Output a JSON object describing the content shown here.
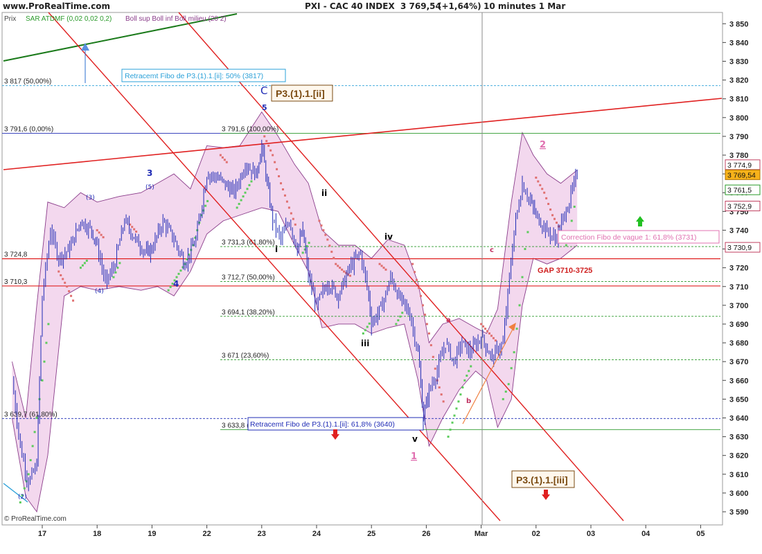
{
  "header": {
    "site": "www.ProRealTime.com",
    "instrument": "PXI - CAC 40 INDEX",
    "last": "3 769,54",
    "change": "(+1,64%)",
    "timeframe": "10 minutes  1 Mar"
  },
  "legend": {
    "price": "Prix",
    "sar": "SAR ATDMF (0,02 0,02 0,2)",
    "boll": "Boll sup Boll inf Boll milieu (20 2)"
  },
  "footer": {
    "copyright": "© ProRealTime.com"
  },
  "colors": {
    "candle": "#1f2bb5",
    "sar_green": "#5ccc5c",
    "sar_red": "#e07070",
    "boll_fill": "#f3d8ee",
    "boll_edge": "#8a3c8a",
    "channel_red": "#e02020",
    "trend_green": "#1a7a1a",
    "fibo_blue": "#1f2bb5",
    "fibo_cyan": "#2aa0d8",
    "fibo_green": "#2a9a2a",
    "label_pink": "#e070b0",
    "gap_red": "#d02020",
    "box_brown": "#7a4a10"
  },
  "chart_data": {
    "type": "candlestick",
    "ylim": [
      3583,
      3856
    ],
    "x_ticks": [
      "17",
      "18",
      "19",
      "22",
      "23",
      "24",
      "25",
      "26",
      "Mar",
      "02",
      "03",
      "04",
      "05"
    ],
    "y_ticks": [
      3590,
      3600,
      3610,
      3620,
      3630,
      3640,
      3650,
      3660,
      3670,
      3680,
      3690,
      3700,
      3710,
      3720,
      3730,
      3740,
      3750,
      3760,
      3770,
      3780,
      3790,
      3800,
      3810,
      3820,
      3830,
      3840,
      3850
    ],
    "y_tick_labels": [
      "3 590",
      "3 600",
      "3 610",
      "3 620",
      "3 630",
      "3 640",
      "3 650",
      "3 660",
      "3 670",
      "3 680",
      "3 690",
      "3 700",
      "3 710",
      "3 720",
      "3 730",
      "3 740",
      "3 750",
      "3 760",
      "3 770",
      "3 780",
      "3 790",
      "3 800",
      "3 810",
      "3 820",
      "3 830",
      "3 840",
      "3 850"
    ],
    "price_path": [
      [
        16.45,
        3660
      ],
      [
        16.6,
        3625
      ],
      [
        16.75,
        3605
      ],
      [
        16.9,
        3615
      ],
      [
        17.0,
        3705
      ],
      [
        17.15,
        3740
      ],
      [
        17.3,
        3725
      ],
      [
        17.5,
        3730
      ],
      [
        17.7,
        3745
      ],
      [
        17.9,
        3740
      ],
      [
        18.0,
        3732
      ],
      [
        18.15,
        3712
      ],
      [
        18.3,
        3720
      ],
      [
        18.5,
        3745
      ],
      [
        18.7,
        3735
      ],
      [
        18.9,
        3728
      ],
      [
        19.0,
        3730
      ],
      [
        19.2,
        3745
      ],
      [
        19.4,
        3735
      ],
      [
        19.6,
        3722
      ],
      [
        19.8,
        3735
      ],
      [
        20.0,
        3770
      ],
      [
        20.2,
        3768
      ],
      [
        20.5,
        3760
      ],
      [
        20.7,
        3775
      ],
      [
        20.9,
        3770
      ],
      [
        21.0,
        3785
      ],
      [
        21.1,
        3765
      ],
      [
        21.2,
        3745
      ],
      [
        21.35,
        3735
      ],
      [
        21.5,
        3745
      ],
      [
        21.65,
        3730
      ],
      [
        21.75,
        3740
      ],
      [
        21.85,
        3715
      ],
      [
        22.0,
        3700
      ],
      [
        22.2,
        3712
      ],
      [
        22.4,
        3705
      ],
      [
        22.6,
        3720
      ],
      [
        22.8,
        3728
      ],
      [
        22.95,
        3705
      ],
      [
        23.0,
        3690
      ],
      [
        23.2,
        3700
      ],
      [
        23.35,
        3715
      ],
      [
        23.5,
        3705
      ],
      [
        23.7,
        3695
      ],
      [
        23.85,
        3675
      ],
      [
        23.95,
        3640
      ],
      [
        24.05,
        3655
      ],
      [
        24.2,
        3665
      ],
      [
        24.35,
        3680
      ],
      [
        24.5,
        3670
      ],
      [
        24.65,
        3680
      ],
      [
        24.8,
        3675
      ],
      [
        25.0,
        3683
      ],
      [
        25.2,
        3672
      ],
      [
        25.4,
        3680
      ],
      [
        25.6,
        3740
      ],
      [
        25.75,
        3765
      ],
      [
        25.9,
        3755
      ],
      [
        26.0,
        3748
      ],
      [
        26.2,
        3740
      ],
      [
        26.35,
        3735
      ],
      [
        26.55,
        3750
      ],
      [
        26.75,
        3770
      ]
    ],
    "bollinger": {
      "upper": [
        [
          16.45,
          3670
        ],
        [
          16.7,
          3640
        ],
        [
          16.9,
          3700
        ],
        [
          17.1,
          3755
        ],
        [
          17.4,
          3752
        ],
        [
          17.7,
          3760
        ],
        [
          18.0,
          3755
        ],
        [
          18.4,
          3758
        ],
        [
          18.8,
          3760
        ],
        [
          19.1,
          3765
        ],
        [
          19.4,
          3770
        ],
        [
          19.7,
          3762
        ],
        [
          20.0,
          3785
        ],
        [
          20.3,
          3784
        ],
        [
          20.6,
          3785
        ],
        [
          21.0,
          3803
        ],
        [
          21.3,
          3790
        ],
        [
          21.6,
          3775
        ],
        [
          21.85,
          3765
        ],
        [
          22.1,
          3740
        ],
        [
          22.4,
          3732
        ],
        [
          22.7,
          3732
        ],
        [
          23.0,
          3725
        ],
        [
          23.3,
          3735
        ],
        [
          23.6,
          3732
        ],
        [
          23.85,
          3712
        ],
        [
          24.05,
          3680
        ],
        [
          24.3,
          3690
        ],
        [
          24.6,
          3693
        ],
        [
          24.9,
          3688
        ],
        [
          25.1,
          3685
        ],
        [
          25.3,
          3698
        ],
        [
          25.55,
          3755
        ],
        [
          25.75,
          3792
        ],
        [
          25.95,
          3780
        ],
        [
          26.2,
          3770
        ],
        [
          26.45,
          3765
        ],
        [
          26.75,
          3772
        ]
      ],
      "lower": [
        [
          16.45,
          3640
        ],
        [
          16.7,
          3598
        ],
        [
          16.9,
          3590
        ],
        [
          17.1,
          3620
        ],
        [
          17.4,
          3705
        ],
        [
          17.7,
          3710
        ],
        [
          18.0,
          3708
        ],
        [
          18.4,
          3710
        ],
        [
          18.8,
          3708
        ],
        [
          19.1,
          3710
        ],
        [
          19.4,
          3705
        ],
        [
          19.7,
          3718
        ],
        [
          20.0,
          3738
        ],
        [
          20.3,
          3745
        ],
        [
          20.6,
          3748
        ],
        [
          21.0,
          3752
        ],
        [
          21.3,
          3750
        ],
        [
          21.6,
          3732
        ],
        [
          21.85,
          3718
        ],
        [
          22.1,
          3688
        ],
        [
          22.4,
          3690
        ],
        [
          22.7,
          3690
        ],
        [
          23.0,
          3685
        ],
        [
          23.3,
          3688
        ],
        [
          23.6,
          3690
        ],
        [
          23.85,
          3660
        ],
        [
          24.05,
          3625
        ],
        [
          24.3,
          3640
        ],
        [
          24.6,
          3655
        ],
        [
          24.9,
          3665
        ],
        [
          25.1,
          3660
        ],
        [
          25.3,
          3635
        ],
        [
          25.55,
          3650
        ],
        [
          25.75,
          3700
        ],
        [
          25.95,
          3725
        ],
        [
          26.2,
          3722
        ],
        [
          26.45,
          3725
        ],
        [
          26.75,
          3732
        ]
      ]
    },
    "sar": [
      {
        "color": "green",
        "points": [
          [
            16.6,
            3595
          ],
          [
            16.75,
            3610
          ],
          [
            16.9,
            3640
          ],
          [
            17.0,
            3660
          ],
          [
            17.15,
            3700
          ]
        ]
      },
      {
        "color": "red",
        "points": [
          [
            17.3,
            3718
          ],
          [
            17.45,
            3710
          ],
          [
            17.6,
            3700
          ]
        ]
      },
      {
        "color": "green",
        "points": [
          [
            17.7,
            3720
          ],
          [
            17.85,
            3725
          ]
        ]
      },
      {
        "color": "red",
        "points": [
          [
            18.0,
            3740
          ],
          [
            18.15,
            3735
          ]
        ]
      },
      {
        "color": "green",
        "points": [
          [
            18.3,
            3715
          ],
          [
            18.45,
            3725
          ]
        ]
      },
      {
        "color": "red",
        "points": [
          [
            18.6,
            3743
          ],
          [
            18.75,
            3738
          ]
        ]
      },
      {
        "color": "green",
        "points": [
          [
            19.3,
            3708
          ],
          [
            19.45,
            3715
          ],
          [
            19.6,
            3722
          ],
          [
            19.75,
            3732
          ],
          [
            19.9,
            3748
          ],
          [
            20.05,
            3758
          ]
        ]
      },
      {
        "color": "red",
        "points": [
          [
            20.25,
            3780
          ],
          [
            20.4,
            3775
          ]
        ]
      },
      {
        "color": "green",
        "points": [
          [
            20.55,
            3752
          ],
          [
            20.7,
            3760
          ],
          [
            20.85,
            3768
          ]
        ]
      },
      {
        "color": "red",
        "points": [
          [
            21.05,
            3790
          ],
          [
            21.2,
            3780
          ],
          [
            21.35,
            3765
          ],
          [
            21.5,
            3752
          ],
          [
            21.65,
            3740
          ]
        ]
      },
      {
        "color": "green",
        "points": [
          [
            21.75,
            3728
          ],
          [
            21.9,
            3735
          ]
        ]
      },
      {
        "color": "red",
        "points": [
          [
            22.05,
            3745
          ],
          [
            22.2,
            3735
          ],
          [
            22.35,
            3722
          ],
          [
            22.5,
            3718
          ],
          [
            22.65,
            3715
          ]
        ]
      },
      {
        "color": "green",
        "points": [
          [
            22.85,
            3685
          ],
          [
            23.0,
            3692
          ]
        ]
      },
      {
        "color": "red",
        "points": [
          [
            23.15,
            3722
          ],
          [
            23.3,
            3718
          ]
        ]
      },
      {
        "color": "green",
        "points": [
          [
            23.45,
            3690
          ],
          [
            23.6,
            3698
          ]
        ]
      },
      {
        "color": "red",
        "points": [
          [
            23.75,
            3722
          ],
          [
            23.9,
            3705
          ],
          [
            24.05,
            3685
          ],
          [
            24.2,
            3660
          ],
          [
            24.35,
            3645
          ]
        ]
      },
      {
        "color": "green",
        "points": [
          [
            24.4,
            3630
          ],
          [
            24.55,
            3645
          ],
          [
            24.7,
            3660
          ],
          [
            24.85,
            3670
          ]
        ]
      },
      {
        "color": "red",
        "points": [
          [
            25.0,
            3690
          ],
          [
            25.15,
            3685
          ],
          [
            25.3,
            3680
          ]
        ]
      },
      {
        "color": "green",
        "points": [
          [
            25.4,
            3650
          ],
          [
            25.5,
            3658
          ],
          [
            25.6,
            3675
          ],
          [
            25.7,
            3700
          ],
          [
            25.8,
            3730
          ],
          [
            25.9,
            3748
          ]
        ]
      },
      {
        "color": "red",
        "points": [
          [
            26.0,
            3768
          ],
          [
            26.15,
            3760
          ],
          [
            26.3,
            3748
          ],
          [
            26.45,
            3740
          ]
        ]
      },
      {
        "color": "green",
        "points": [
          [
            26.55,
            3732
          ],
          [
            26.65,
            3745
          ],
          [
            26.75,
            3760
          ]
        ]
      }
    ],
    "hlines": [
      {
        "value": 3817,
        "color": "cyan",
        "dash": true,
        "label": "3 817 (50,00%)",
        "x_end": 1040
      },
      {
        "value": 3791.6,
        "color": "blue",
        "dash": false,
        "label": "3 791,6 (0,00%)",
        "x_start": 0,
        "x_end": 380
      },
      {
        "value": 3791.6,
        "color": "green",
        "dash": false,
        "label": "3 791,6 (100,00%)",
        "x_start": 318,
        "x_end": 1040
      },
      {
        "value": 3731.3,
        "color": "green",
        "dash": true,
        "label": "3 731,3 (61,80%)",
        "x_start": 318,
        "x_end": 1040
      },
      {
        "value": 3724.8,
        "color": "red",
        "dash": false,
        "label": "3 724,8",
        "x_start": 0,
        "x_end": 1040
      },
      {
        "value": 3712.7,
        "color": "green",
        "dash": true,
        "label": "3 712,7 (50,00%)",
        "x_start": 318,
        "x_end": 1040
      },
      {
        "value": 3710.3,
        "color": "red",
        "dash": false,
        "label": "3 710,3",
        "x_start": 0,
        "x_end": 1040
      },
      {
        "value": 3694.1,
        "color": "green",
        "dash": true,
        "label": "3 694,1 (38,20%)",
        "x_start": 318,
        "x_end": 1040
      },
      {
        "value": 3671,
        "color": "green",
        "dash": true,
        "label": "3 671 (23,60%)",
        "x_start": 318,
        "x_end": 1040
      },
      {
        "value": 3639.7,
        "color": "blue",
        "dash": true,
        "label": "3 639,7 (61,80%)",
        "x_start": 0,
        "x_end": 1040
      },
      {
        "value": 3633.8,
        "color": "green",
        "dash": false,
        "label": "3 633,8 (0,00%)",
        "x_start": 318,
        "x_end": 1040
      }
    ],
    "price_boxes": [
      {
        "value": 3774.9,
        "label": "3 774,9",
        "style": "outline"
      },
      {
        "value": 3769.54,
        "label": "3 769,54",
        "style": "current"
      },
      {
        "value": 3761.5,
        "label": "3 761,5",
        "style": "outline-green"
      },
      {
        "value": 3752.9,
        "label": "3 752,9",
        "style": "outline"
      },
      {
        "value": 3730.9,
        "label": "3 730,9",
        "style": "outline"
      }
    ],
    "annotations": {
      "fibo_box_top": "Retracemt Fibo de P3.(1).1.[ii]: 50% (3817)",
      "fibo_box_bottom": "Retracemt Fibo de P3.(1).1.[ii]: 61,8% (3640)",
      "correction": "Correction Fibo de vague 1: 61,8% (3731)",
      "gap": "GAP 3710-3725",
      "wave_box_top": "P3.(1).1.[ii]",
      "wave_box_bottom": "P3.(1).1.[iii]",
      "wave_labels": [
        "(2)",
        "(3)",
        "(4)",
        "(5)",
        "3",
        "4",
        "5",
        "C",
        "i",
        "ii",
        "iii",
        "iv",
        "v",
        "a",
        "b",
        "c",
        "1",
        "2"
      ]
    }
  }
}
